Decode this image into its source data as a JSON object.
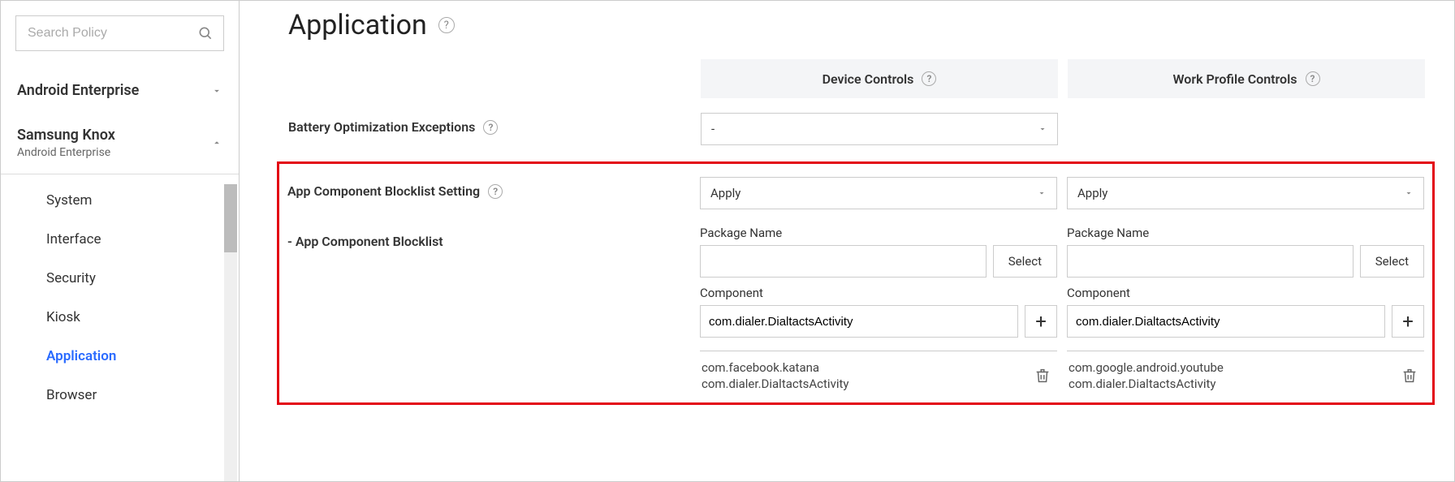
{
  "sidebar": {
    "search_placeholder": "Search Policy",
    "top_nav": {
      "label": "Android Enterprise"
    },
    "group": {
      "title": "Samsung Knox",
      "subtitle": "Android Enterprise"
    },
    "items": [
      {
        "label": "System"
      },
      {
        "label": "Interface"
      },
      {
        "label": "Security"
      },
      {
        "label": "Kiosk"
      },
      {
        "label": "Application",
        "active": true
      },
      {
        "label": "Browser"
      }
    ]
  },
  "main": {
    "title": "Application",
    "columns": {
      "device": "Device Controls",
      "work": "Work Profile Controls"
    },
    "rows": {
      "battery": {
        "label": "Battery Optimization Exceptions",
        "device_value": "-"
      },
      "blocklist_setting": {
        "label": "App Component Blocklist Setting",
        "device_value": "Apply",
        "work_value": "Apply"
      },
      "blocklist": {
        "label": "- App Component Blocklist",
        "package_label": "Package Name",
        "component_label": "Component",
        "select_btn": "Select",
        "device": {
          "component_value": "com.dialer.DialtactsActivity",
          "list_line1": "com.facebook.katana",
          "list_line2": "com.dialer.DialtactsActivity"
        },
        "work": {
          "component_value": "com.dialer.DialtactsActivity",
          "list_line1": "com.google.android.youtube",
          "list_line2": "com.dialer.DialtactsActivity"
        }
      }
    }
  }
}
